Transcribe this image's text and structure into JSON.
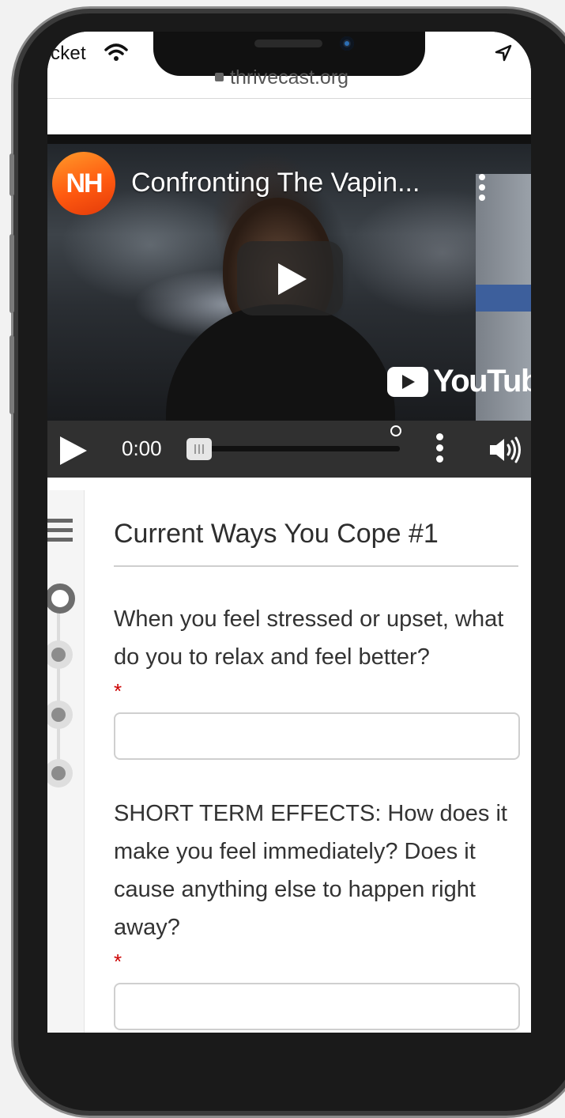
{
  "status_bar": {
    "carrier": "cket",
    "url": "thrivecast.org"
  },
  "video": {
    "channel_logo_text": "NH",
    "title": "Confronting The Vapin...",
    "platform_label": "YouTube",
    "colors": {
      "logo_gradient_start": "#ff9a2a",
      "logo_gradient_end": "#e33a0a"
    }
  },
  "player": {
    "current_time": "0:00",
    "progress": 0.0
  },
  "form": {
    "section_title": "Current Ways You Cope #1",
    "questions": [
      {
        "text": "When you feel stressed or upset, what do you to relax and feel better?",
        "required_marker": "*",
        "value": ""
      },
      {
        "text": "SHORT TERM EFFECTS: How does it make you feel immediately? Does it cause anything else to happen right away?",
        "required_marker": "*",
        "value": ""
      }
    ],
    "steps": [
      {
        "state": "active"
      },
      {
        "state": "pending"
      },
      {
        "state": "pending"
      },
      {
        "state": "pending"
      }
    ]
  },
  "icons": {
    "status": [
      "wifi-icon",
      "location-arrow-icon",
      "lock-icon"
    ],
    "player": [
      "play-icon",
      "more-vertical-icon",
      "volume-icon"
    ],
    "form": [
      "hamburger-menu-icon"
    ]
  }
}
